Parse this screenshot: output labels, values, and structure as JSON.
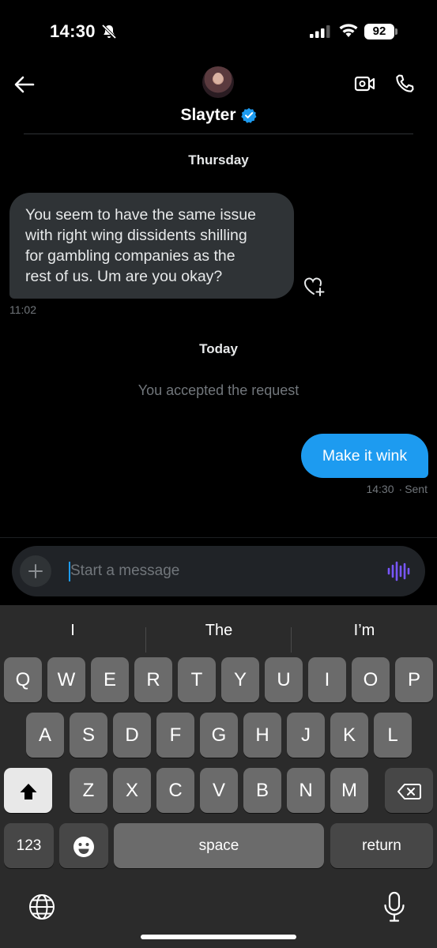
{
  "status_bar": {
    "time": "14:30",
    "battery": "92"
  },
  "header": {
    "contact_name": "Slayter"
  },
  "conversation": {
    "day1": "Thursday",
    "incoming": {
      "lines": [
        "You seem to have the same issue",
        "with right wing dissidents shilling",
        "for gambling companies as the",
        "rest of us. Um are you okay?"
      ],
      "time": "11:02"
    },
    "day2": "Today",
    "system": "You accepted the request",
    "outgoing": {
      "text": "Make it wink",
      "time": "14:30",
      "status": "Sent"
    }
  },
  "composer": {
    "placeholder": "Start a message"
  },
  "keyboard": {
    "suggestions": [
      "I",
      "The",
      "I’m"
    ],
    "row1": [
      "Q",
      "W",
      "E",
      "R",
      "T",
      "Y",
      "U",
      "I",
      "O",
      "P"
    ],
    "row2": [
      "A",
      "S",
      "D",
      "F",
      "G",
      "H",
      "J",
      "K",
      "L"
    ],
    "row3": [
      "Z",
      "X",
      "C",
      "V",
      "B",
      "N",
      "M"
    ],
    "numbers_label": "123",
    "space_label": "space",
    "return_label": "return"
  },
  "colors": {
    "accent": "#1d9bf0",
    "bubble_incoming": "#2f3336",
    "voice": "#7856ff"
  }
}
